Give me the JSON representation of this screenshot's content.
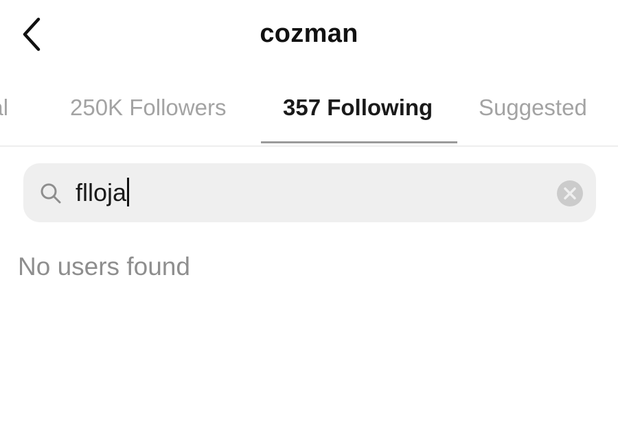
{
  "header": {
    "title": "cozman",
    "back_icon": "chevron-left-icon"
  },
  "tabs": [
    {
      "label": "ual",
      "active": false
    },
    {
      "label": "250K Followers",
      "active": false
    },
    {
      "label": "357 Following",
      "active": true
    },
    {
      "label": "Suggested",
      "active": false
    }
  ],
  "search": {
    "value": "flloja",
    "icon": "search-icon",
    "clear_icon": "clear-circle-icon"
  },
  "results": {
    "empty_message": "No users found"
  },
  "colors": {
    "background": "#ffffff",
    "search_bg": "#efefef",
    "muted_text": "#8e8e8e",
    "inactive_tab": "#a3a3a3",
    "active_tab": "#1a1a1a"
  }
}
